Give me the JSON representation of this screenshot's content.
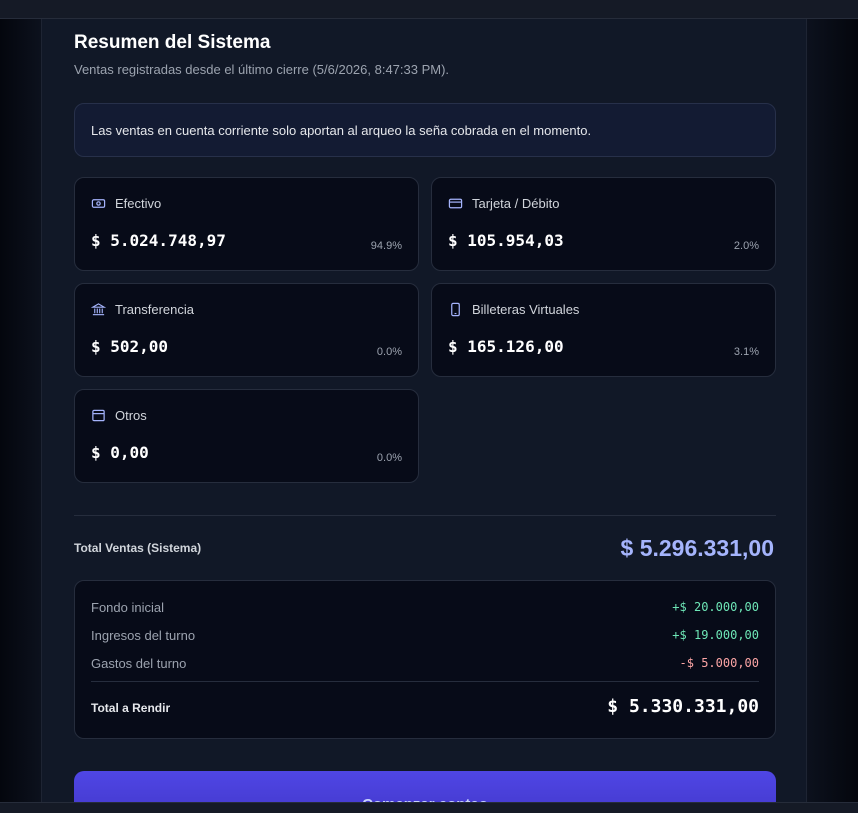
{
  "header": {
    "title": "Resumen del Sistema",
    "subtitle": "Ventas registradas desde el último cierre (5/6/2026, 8:47:33 PM)."
  },
  "notice": "Las ventas en cuenta corriente solo aportan al arqueo la seña cobrada en el momento.",
  "methods": [
    {
      "label": "Efectivo",
      "amount": "$ 5.024.748,97",
      "percent": "94.9%",
      "icon": "cash-icon"
    },
    {
      "label": "Tarjeta / Débito",
      "amount": "$ 105.954,03",
      "percent": "2.0%",
      "icon": "credit-card-icon"
    },
    {
      "label": "Transferencia",
      "amount": "$ 502,00",
      "percent": "0.0%",
      "icon": "bank-icon"
    },
    {
      "label": "Billeteras Virtuales",
      "amount": "$ 165.126,00",
      "percent": "3.1%",
      "icon": "smartphone-icon"
    },
    {
      "label": "Otros",
      "amount": "$ 0,00",
      "percent": "0.0%",
      "icon": "archive-icon"
    }
  ],
  "totals": {
    "sales_label": "Total Ventas (Sistema)",
    "sales_value": "$ 5.296.331,00",
    "rows": [
      {
        "label": "Fondo inicial",
        "value": "+$ 20.000,00"
      },
      {
        "label": "Ingresos del turno",
        "value": "+$ 19.000,00"
      },
      {
        "label": "Gastos del turno",
        "value": "-$ 5.000,00"
      }
    ],
    "rendir_label": "Total a Rendir",
    "rendir_value": "$ 5.330.331,00"
  },
  "actions": {
    "start_count": "Comenzar conteo"
  },
  "colors": {
    "accent": "#a5b4fc",
    "positive": "#6ee7b7",
    "negative": "#fca5a5",
    "button": "#4f46e5"
  }
}
